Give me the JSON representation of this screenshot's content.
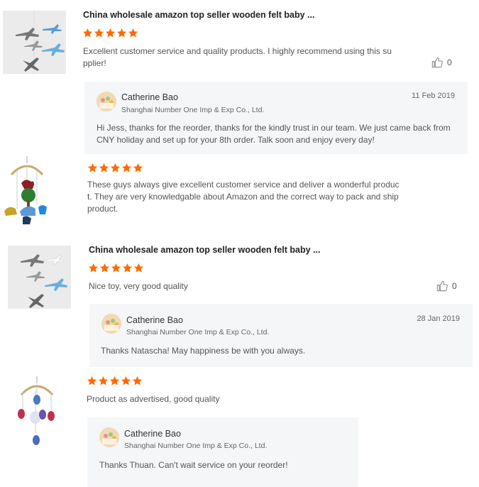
{
  "reviews": [
    {
      "product_title": "China wholesale amazon top seller wooden felt baby ...",
      "rating": 5,
      "text": "Excellent customer service and quality products. I highly recommend using this supplier!",
      "likes": "0",
      "reply": {
        "name": "Catherine Bao",
        "company": "Shanghai Number One Imp & Exp Co., Ltd.",
        "date": "11 Feb 2019",
        "text": "Hi Jess, thanks for the reorder, thanks for the kindly trust in our team. We just came back from CNY holiday and set up for your 8th order. Talk soon and enjoy every day!"
      }
    },
    {
      "rating": 5,
      "text": "These guys always give excellent customer service and deliver a wonderful product. They are very knowledgable about Amazon and the correct way to pack and ship product."
    },
    {
      "product_title": "China wholesale amazon top seller wooden felt baby ...",
      "rating": 5,
      "text": "Nice toy, very good quality",
      "likes": "0",
      "reply": {
        "name": "Catherine Bao",
        "company": "Shanghai Number One Imp & Exp Co., Ltd.",
        "date": "28 Jan 2019",
        "text": "Thanks Natascha! May happiness be with you always."
      }
    },
    {
      "rating": 5,
      "text": "Product as advertised, good quality",
      "reply": {
        "name": "Catherine Bao",
        "company": "Shanghai Number One Imp & Exp Co., Ltd.",
        "text": "Thanks Thuan. Can't wait service on your reorder!"
      }
    }
  ],
  "colors": {
    "star": "#ff6a00",
    "reply_bg": "#f5f6f8"
  },
  "icons": {
    "star": "star-icon",
    "like": "thumbs-up-icon"
  }
}
